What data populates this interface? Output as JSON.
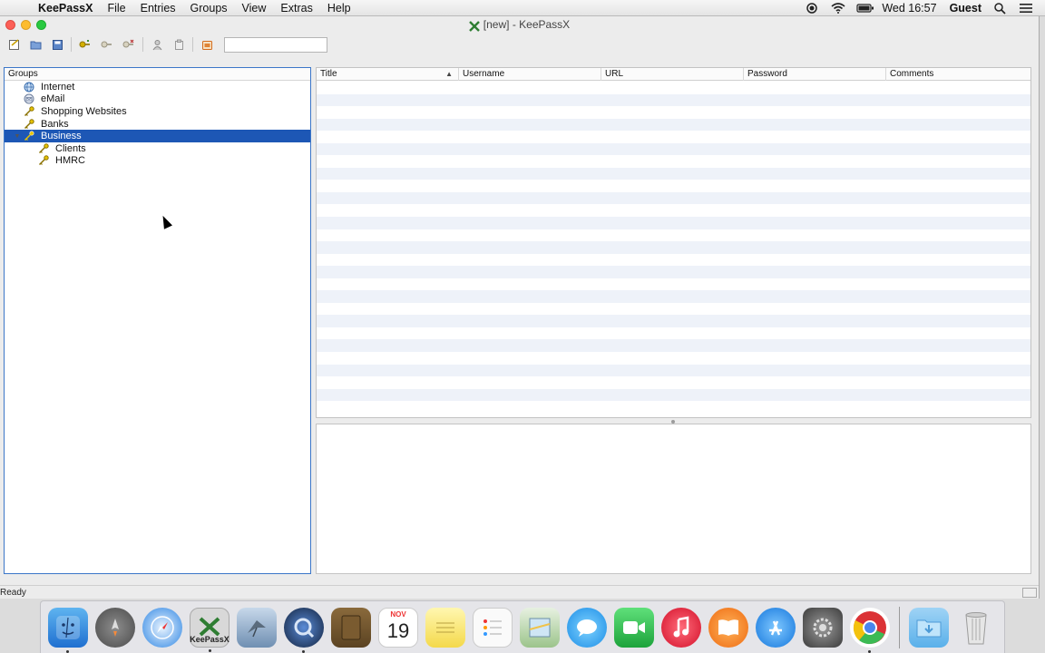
{
  "menubar": {
    "app_name": "KeePassX",
    "menus": [
      "File",
      "Entries",
      "Groups",
      "View",
      "Extras",
      "Help"
    ],
    "clock": "Wed 16:57",
    "user": "Guest"
  },
  "window": {
    "title": "[new] - KeePassX",
    "search_value": ""
  },
  "groups": {
    "header": "Groups",
    "items": [
      {
        "label": "Internet",
        "icon": "globe-icon"
      },
      {
        "label": "eMail",
        "icon": "mail-icon"
      },
      {
        "label": "Shopping Websites",
        "icon": "key-icon"
      },
      {
        "label": "Banks",
        "icon": "key-icon"
      },
      {
        "label": "Business",
        "icon": "key-icon"
      },
      {
        "label": "Clients",
        "icon": "key-icon"
      },
      {
        "label": "HMRC",
        "icon": "key-icon"
      }
    ]
  },
  "entries": {
    "columns": [
      "Title",
      "Username",
      "URL",
      "Password",
      "Comments"
    ]
  },
  "status": "Ready",
  "dock": {
    "keepassx_label": "KeePassX",
    "calendar_month": "NOV",
    "calendar_day": "19"
  }
}
